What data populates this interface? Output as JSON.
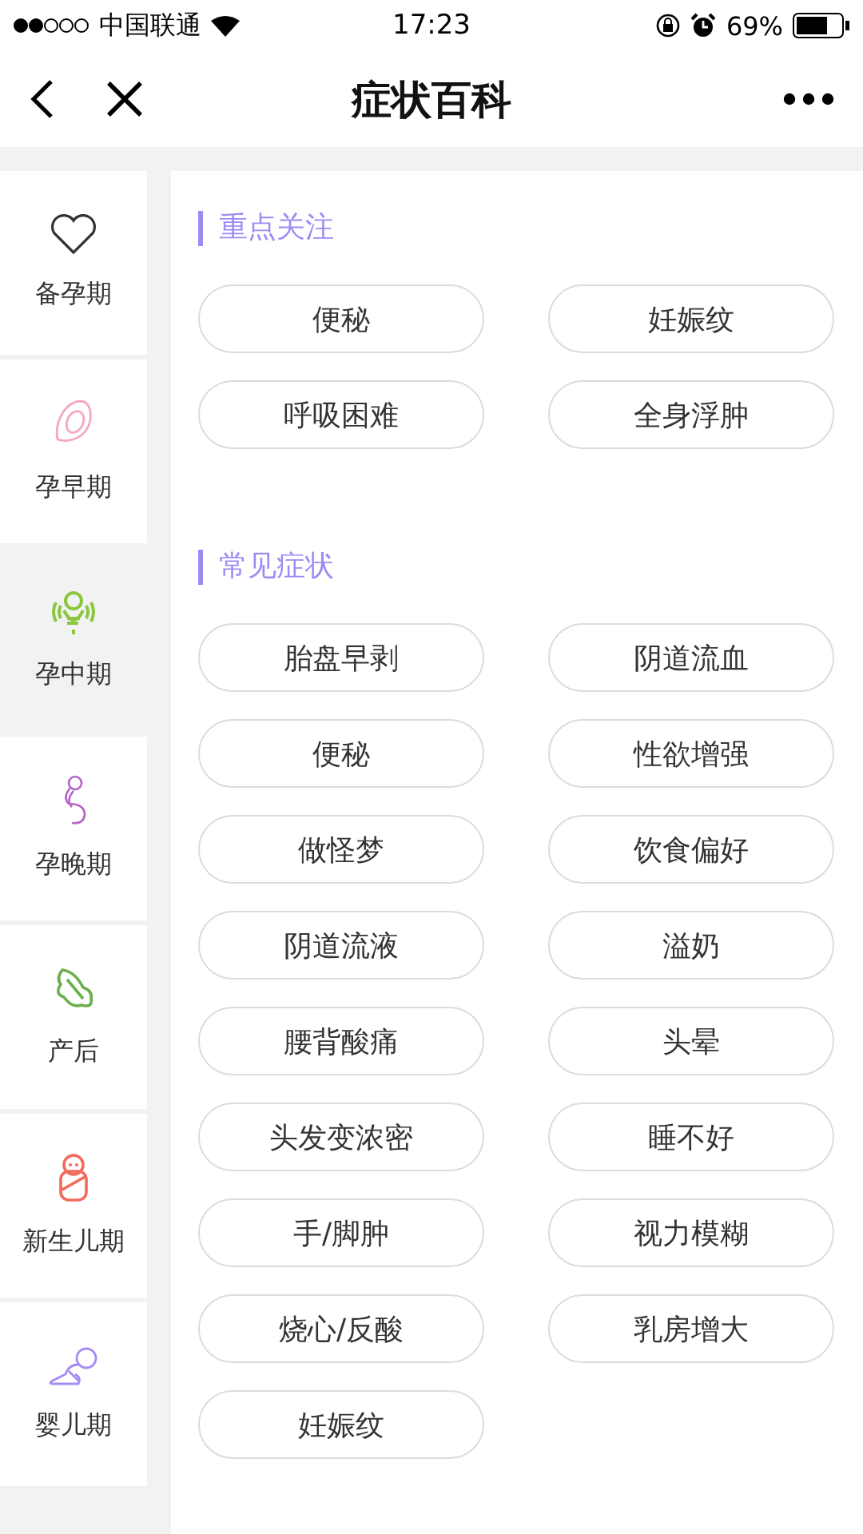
{
  "status_bar": {
    "carrier": "中国联通",
    "time": "17:23",
    "battery": "69%"
  },
  "nav": {
    "title": "症状百科"
  },
  "sidebar": {
    "items": [
      {
        "label": "备孕期",
        "selected": false
      },
      {
        "label": "孕早期",
        "selected": false
      },
      {
        "label": "孕中期",
        "selected": true
      },
      {
        "label": "孕晚期",
        "selected": false
      },
      {
        "label": "产后",
        "selected": false
      },
      {
        "label": "新生儿期",
        "selected": false
      },
      {
        "label": "婴儿期",
        "selected": false
      }
    ]
  },
  "sections": [
    {
      "title": "重点关注",
      "tags": [
        "便秘",
        "妊娠纹",
        "呼吸困难",
        "全身浮肿"
      ]
    },
    {
      "title": "常见症状",
      "tags": [
        "胎盘早剥",
        "阴道流血",
        "便秘",
        "性欲增强",
        "做怪梦",
        "饮食偏好",
        "阴道流液",
        "溢奶",
        "腰背酸痛",
        "头晕",
        "头发变浓密",
        "睡不好",
        "手/脚肿",
        "视力模糊",
        "烧心/反酸",
        "乳房增大",
        "妊娠纹"
      ]
    }
  ]
}
